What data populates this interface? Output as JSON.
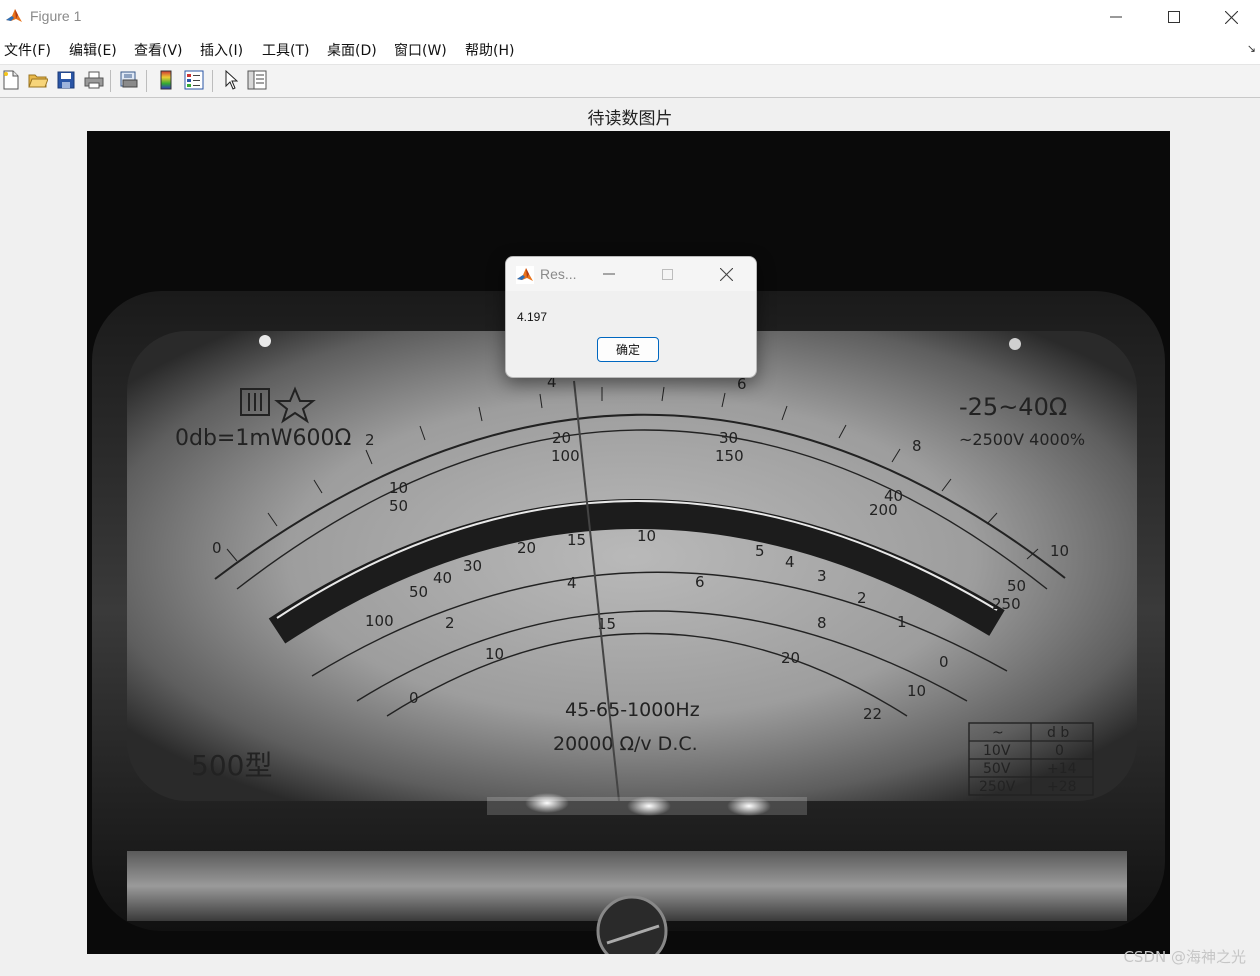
{
  "window": {
    "title": "Figure 1",
    "icon": "matlab-icon",
    "controls": [
      "minimize-icon",
      "maximize-icon",
      "close-icon"
    ]
  },
  "menu": {
    "items": [
      {
        "label": "文件(F)"
      },
      {
        "label": "编辑(E)"
      },
      {
        "label": "查看(V)"
      },
      {
        "label": "插入(I)"
      },
      {
        "label": "工具(T)"
      },
      {
        "label": "桌面(D)"
      },
      {
        "label": "窗口(W)"
      },
      {
        "label": "帮助(H)"
      }
    ],
    "dock_icon": "dock-arrow-icon"
  },
  "toolbar": {
    "buttons": [
      "new-figure-icon",
      "open-file-icon",
      "save-icon",
      "print-icon",
      "print-preview-icon",
      "colorbar-icon",
      "legend-icon",
      "pointer-icon",
      "property-editor-icon"
    ]
  },
  "figure": {
    "title": "待读数图片",
    "meter": {
      "badge_top_left": "0db=1mW600Ω",
      "range_top_right": "-25~40Ω",
      "spec_top_right": "~2500V 4000%",
      "outer_scale": [
        "0",
        "2",
        "4",
        "6",
        "8",
        "10"
      ],
      "second_scale": [
        "10",
        "20",
        "30",
        "40",
        "50"
      ],
      "third_scale": [
        "50",
        "100",
        "150",
        "200",
        "250"
      ],
      "ohm_scale": [
        "100",
        "50",
        "40",
        "30",
        "20",
        "15",
        "10",
        "5",
        "4",
        "3",
        "2",
        "1",
        "0"
      ],
      "ac_scale": [
        "2",
        "4",
        "6",
        "8",
        "10"
      ],
      "db_scale": [
        "0",
        "10",
        "15",
        "20",
        "22"
      ],
      "freq_text": "45-65-1000Hz",
      "sens_text": "20000 Ω/v D.C.",
      "model_text": "500型",
      "table_headers": [
        "~",
        "d b"
      ],
      "table_rows": [
        [
          "10V",
          "0"
        ],
        [
          "50V",
          "+14"
        ],
        [
          "250V",
          "+28"
        ]
      ]
    }
  },
  "dialog": {
    "title": "Res...",
    "message": "4.197",
    "ok_label": "确定"
  },
  "watermark": "CSDN @海神之光"
}
